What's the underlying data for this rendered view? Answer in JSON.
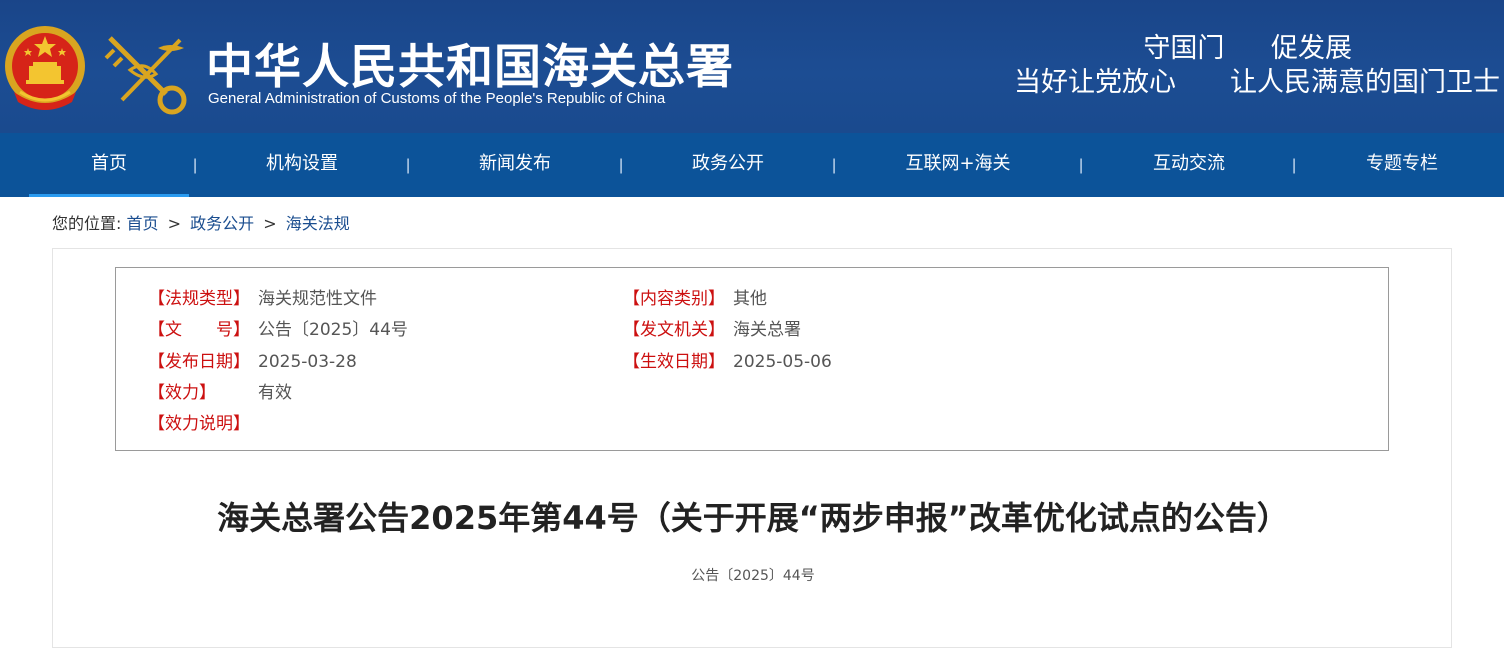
{
  "header": {
    "org_name_cn": "中华人民共和国海关总署",
    "org_name_en": "General Administration of Customs of the People's Republic of China",
    "slogan_line1": "守国门 促发展",
    "slogan_line2": "当好让党放心　　让人民满意的国门卫士",
    "emblem_icon": "national-emblem-icon",
    "logo_icon": "customs-key-caduceus-icon"
  },
  "nav": {
    "items": [
      {
        "label": "首页",
        "active": true
      },
      {
        "label": "机构设置"
      },
      {
        "label": "新闻发布"
      },
      {
        "label": "政务公开"
      },
      {
        "label": "互联网+海关"
      },
      {
        "label": "互动交流"
      },
      {
        "label": "专题专栏"
      }
    ],
    "separator": "|"
  },
  "breadcrumb": {
    "prefix": "您的位置:",
    "items": [
      "首页",
      "政务公开",
      "海关法规"
    ],
    "separator": ">"
  },
  "meta": {
    "law_type_key": "【法规类型】",
    "law_type_val": "海关规范性文件",
    "content_cat_key": "【内容类别】",
    "content_cat_val": "其他",
    "doc_no_key": "【文　　号】",
    "doc_no_val": "公告〔2025〕44号",
    "issuer_key": "【发文机关】",
    "issuer_val": "海关总署",
    "pub_date_key": "【发布日期】",
    "pub_date_val": "2025-03-28",
    "eff_date_key": "【生效日期】",
    "eff_date_val": "2025-05-06",
    "validity_key": "【效力】",
    "validity_val": "有效",
    "validity_note_key": "【效力说明】"
  },
  "article": {
    "title": "海关总署公告2025年第44号（关于开展“两步申报”改革优化试点的公告）",
    "doc_no": "公告〔2025〕44号"
  },
  "colors": {
    "banner_bg": "#1a4589",
    "nav_bg": "#0c5399",
    "nav_active_underline": "#2a9bf0",
    "meta_key_red": "#cc1010",
    "link_blue": "#1a4d8f"
  }
}
